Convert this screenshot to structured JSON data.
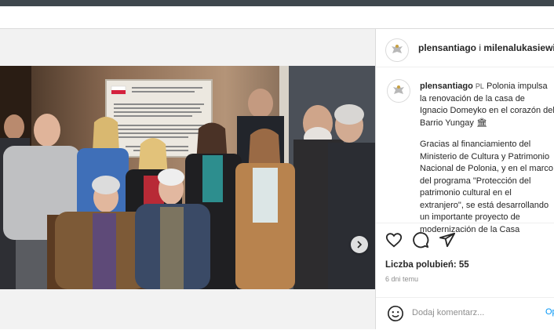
{
  "post": {
    "header_username": "plensantiago",
    "header_separator": " i ",
    "header_collaborator": "milenalukasiewicz",
    "caption": {
      "username": "plensantiago",
      "lang_tag": "PL",
      "line1": "Polonia impulsa la renovación de la casa de Ignacio Domeyko en el corazón del Barrio Yungay",
      "emoji": "🏛",
      "paragraph2": "Gracias al financiamiento del Ministerio de Cultura y Patrimonio Nacional de Polonia, y en el marco del programa \"Protección del patrimonio cultural en el extranjero\", se está desarrollando un importante proyecto de modernización de la Casa"
    },
    "likes_text": "Liczba polubień: 55",
    "time_text": "6 dni temu",
    "comment_placeholder": "Dodaj komentarz...",
    "post_button": "Opublikuj"
  },
  "icons": {
    "avatar": "polish-eagle-emblem-icon",
    "like": "heart-outline-icon",
    "comment": "speech-bubble-icon",
    "share": "paper-plane-icon",
    "emoji": "smiley-icon",
    "next": "chevron-right-icon"
  },
  "colors": {
    "top_bar": "#3f474d",
    "background": "#f2f2f2",
    "link": "#0095f6",
    "text": "#262626",
    "muted": "#8e8e8e"
  }
}
